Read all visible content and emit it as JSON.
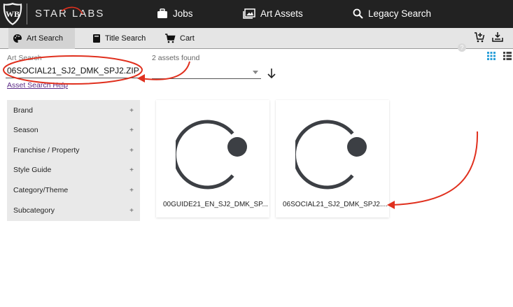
{
  "header": {
    "brand": "STAR LABS",
    "nav": [
      {
        "label": "Jobs",
        "icon": "briefcase-icon"
      },
      {
        "label": "Art Assets",
        "icon": "images-icon"
      },
      {
        "label": "Legacy Search",
        "icon": "search-icon"
      }
    ]
  },
  "tabs": [
    {
      "label": "Art Search",
      "icon": "palette-icon",
      "active": true
    },
    {
      "label": "Title Search",
      "icon": "book-icon",
      "active": false
    },
    {
      "label": "Cart",
      "icon": "cart-icon",
      "active": false
    }
  ],
  "search": {
    "label": "Art Search",
    "value": "06SOCIAL21_SJ2_DMK_SPJ2.ZIP",
    "help_link": "Asset Search Help"
  },
  "results": {
    "count_text": "2 assets found"
  },
  "facets": [
    {
      "label": "Brand",
      "toggle": "+"
    },
    {
      "label": "Season",
      "toggle": "+"
    },
    {
      "label": "Franchise / Property",
      "toggle": "+"
    },
    {
      "label": "Style Guide",
      "toggle": "+"
    },
    {
      "label": "Category/Theme",
      "toggle": "+"
    },
    {
      "label": "Subcategory",
      "toggle": "+"
    }
  ],
  "assets": [
    {
      "name": "00GUIDE21_EN_SJ2_DMK_SP..."
    },
    {
      "name": "06SOCIAL21_SJ2_DMK_SPJ2...."
    }
  ],
  "colors": {
    "header_bg": "#222222",
    "tabbar_bg": "#e5e5e5",
    "annotation": "#e0301e",
    "grid_view_active": "#2a9fd8"
  }
}
